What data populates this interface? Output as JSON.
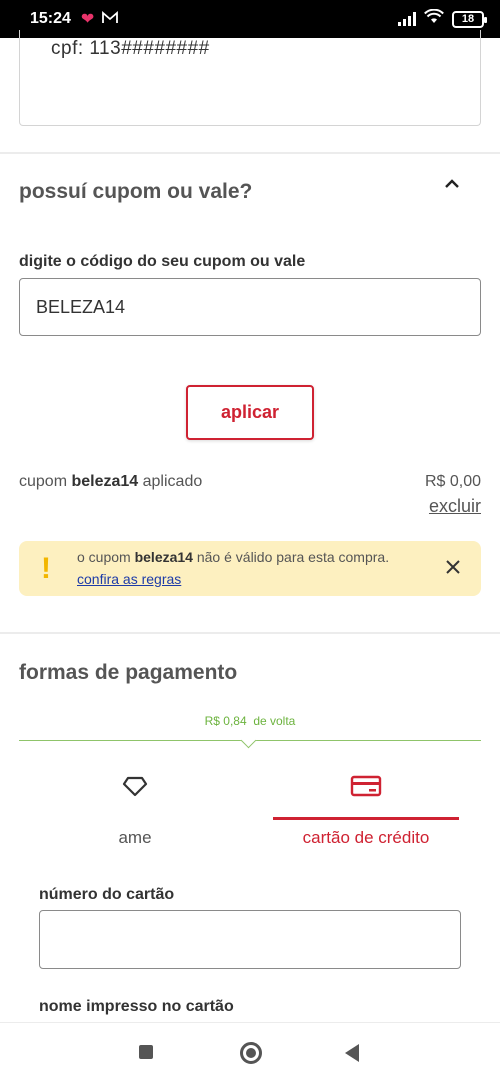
{
  "status_bar": {
    "time": "15:24",
    "heart_icon": "heart-icon",
    "mail_icon": "gmail-icon",
    "battery": "18"
  },
  "cpf": {
    "text": "cpf: 113########"
  },
  "coupon_section": {
    "title": "possuí cupom ou vale?",
    "collapse_icon": "chevron-up-icon",
    "field_label": "digite o código do seu cupom ou vale",
    "field_value": "BELEZA14",
    "apply_button": "aplicar",
    "applied_prefix": "cupom ",
    "applied_code": "beleza14",
    "applied_suffix": " aplicado",
    "applied_value": "R$ 0,00",
    "remove_link": "excluir"
  },
  "alert": {
    "prefix": "o cupom ",
    "code": "beleza14",
    "suffix": " não é válido para esta compra.",
    "rules_link": "confira as regras",
    "colors": {
      "background": "#fdf0c0",
      "icon": "#f2b600"
    }
  },
  "payment": {
    "title": "formas de pagamento",
    "cashback_value": "R$ 0,84",
    "cashback_label": "de volta",
    "tabs": [
      {
        "label": "ame",
        "icon": "ame-heart-icon",
        "selected": false
      },
      {
        "label": "cartão de crédito",
        "icon": "credit-card-icon",
        "selected": true
      }
    ],
    "card_number_label": "número do cartão",
    "card_number_value": "",
    "name_on_card_label": "nome impresso no cartão"
  },
  "colors": {
    "accent": "#cf2232",
    "cashback": "#6cb33e",
    "link": "#1d3ba8"
  }
}
